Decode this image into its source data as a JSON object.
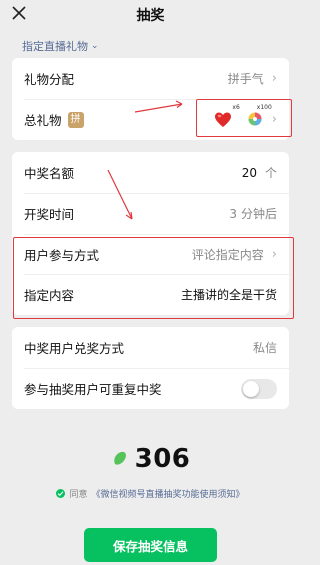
{
  "header": {
    "title": "抽奖"
  },
  "subtab": {
    "label": "指定直播礼物"
  },
  "gift_card": {
    "distribution_label": "礼物分配",
    "distribution_value": "拼手气",
    "total_label": "总礼物",
    "total_badge": "拼",
    "gifts": [
      {
        "icon": "heart-gift-icon",
        "count": "x6"
      },
      {
        "icon": "lollipop-gift-icon",
        "count": "x100"
      }
    ]
  },
  "prize_card": {
    "winners_label": "中奖名额",
    "winners_value": "20",
    "winners_unit": "个",
    "draw_time_label": "开奖时间",
    "draw_time_value": "3",
    "draw_time_unit": "分钟后",
    "method_label": "用户参与方式",
    "method_value": "评论指定内容",
    "content_label": "指定内容",
    "content_value": "主播讲的全是干货"
  },
  "redeem_card": {
    "redeem_label": "中奖用户兑奖方式",
    "redeem_value": "私信",
    "repeat_label": "参与抽奖用户可重复中奖",
    "repeat_enabled": false
  },
  "footer": {
    "bean_count": "306",
    "agree_prefix": "同意",
    "agree_link": "《微信视频号直播抽奖功能使用须知》",
    "save_label": "保存抽奖信息"
  },
  "colors": {
    "accent_green": "#07c160",
    "link_blue": "#576b95",
    "annotation_red": "#e0393e"
  }
}
